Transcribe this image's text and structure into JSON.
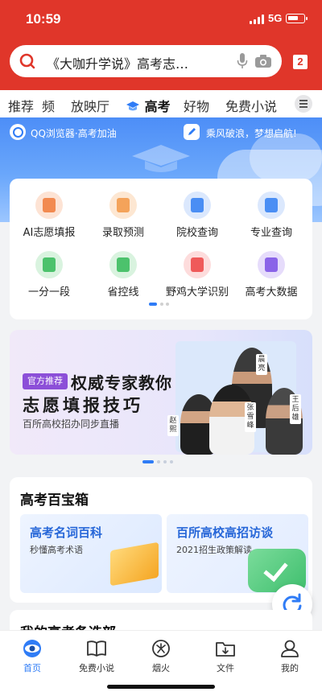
{
  "status_bar": {
    "time": "10:59",
    "network": "5G"
  },
  "search": {
    "text": "《大咖升学说》高考志…",
    "tabs_count": "2"
  },
  "channels": [
    {
      "label": "推荐"
    },
    {
      "label": "频"
    },
    {
      "label": "放映厅"
    },
    {
      "label": "高考"
    },
    {
      "label": "好物"
    },
    {
      "label": "免费小说"
    }
  ],
  "active_channel": "高考",
  "banner": {
    "badge": "QQ浏览器·高考加油",
    "slogan": "乘风破浪，梦想启航!"
  },
  "tools": [
    {
      "label": "AI志愿填报",
      "icon": "form-icon",
      "color": "#f28a50"
    },
    {
      "label": "录取预测",
      "icon": "envelope-icon",
      "color": "#f4a35a"
    },
    {
      "label": "院校查询",
      "icon": "school-search-icon",
      "color": "#4a8ef4"
    },
    {
      "label": "专业查询",
      "icon": "major-search-icon",
      "color": "#4a8ef4"
    },
    {
      "label": "一分一段",
      "icon": "table-icon",
      "color": "#4cc26c"
    },
    {
      "label": "省控线",
      "icon": "trend-chart-icon",
      "color": "#4cc26c"
    },
    {
      "label": "野鸡大学识别",
      "icon": "warning-house-icon",
      "color": "#ef5a5a"
    },
    {
      "label": "高考大数据",
      "icon": "bar-chart-icon",
      "color": "#8a63e8"
    }
  ],
  "promo": {
    "tag": "官方推荐",
    "headline1": "权威专家教你",
    "headline2": "志愿填报技巧",
    "subtitle": "百所高校招办同步直播",
    "names": [
      "晨亮",
      "王后雄",
      "张雪峰",
      "赵熙"
    ]
  },
  "treasure_box": {
    "title": "高考百宝箱",
    "cards": [
      {
        "title": "高考名词百科",
        "subtitle": "秒懂高考术语"
      },
      {
        "title": "百所高校高招访谈",
        "subtitle": "2021招生政策解读"
      }
    ]
  },
  "next_section": {
    "title": "我的高考备选部"
  },
  "bottom_nav": [
    {
      "label": "首页",
      "icon": "home-eye-icon",
      "active": true
    },
    {
      "label": "免费小说",
      "icon": "book-icon",
      "active": false
    },
    {
      "label": "烟火",
      "icon": "firework-icon",
      "active": false
    },
    {
      "label": "文件",
      "icon": "folder-download-icon",
      "active": false
    },
    {
      "label": "我的",
      "icon": "user-icon",
      "active": false
    }
  ],
  "colors": {
    "brand_red": "#e0362a",
    "accent_blue": "#2f7cf6",
    "link_blue": "#2767d8"
  }
}
